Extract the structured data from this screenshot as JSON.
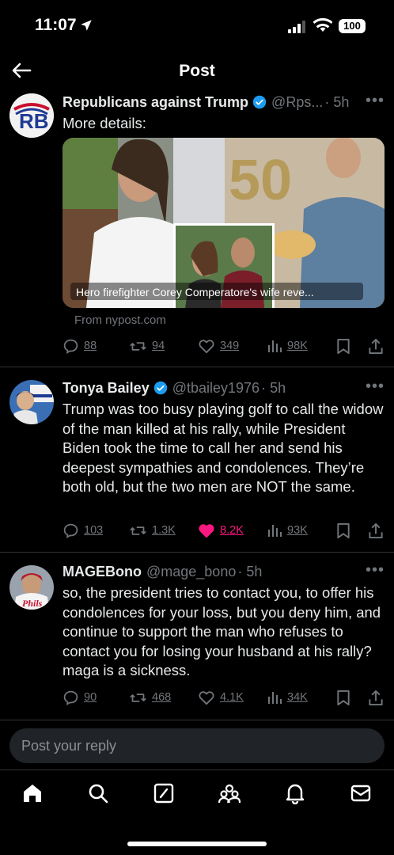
{
  "status_bar": {
    "time": "11:07",
    "battery": "100"
  },
  "header": {
    "title": "Post"
  },
  "posts": [
    {
      "name": "Republicans against Trump",
      "handle": "@Rps...",
      "time": "· 5h",
      "text": "More details:",
      "avatar_text": "RB",
      "link_caption": "Hero firefighter Corey Comperatore's wife reve...",
      "link_source": "From nypost.com",
      "replies": "88",
      "reposts": "94",
      "likes": "349",
      "views": "98K"
    },
    {
      "name": "Tonya Bailey",
      "handle": "@tbailey1976",
      "time": "· 5h",
      "text": "Trump was too busy playing golf to call the widow of the man killed at his rally, while President Biden took the time to call her and send his deepest sympathies and condolences. They’re both old, but the two men are NOT the same.",
      "replies": "103",
      "reposts": "1.3K",
      "likes": "8.2K",
      "views": "93K"
    },
    {
      "name": "MAGEBono",
      "handle": "@mage_bono",
      "time": "· 5h",
      "text": "so, the president tries to contact you, to offer his condolences for your loss, but you deny him, and continue to support the man who refuses to contact you for losing your husband at his rally? maga is a sickness.",
      "replies": "90",
      "reposts": "468",
      "likes": "4.1K",
      "views": "34K"
    }
  ],
  "reply_bar": {
    "placeholder": "Post your reply"
  },
  "colors": {
    "background": "#000000",
    "accent": "#1d9bf0",
    "like": "#f91880",
    "muted": "#71767b"
  },
  "icons": [
    "arrow-left-icon",
    "verified-icon",
    "more-icon",
    "reply-icon",
    "repost-icon",
    "like-icon",
    "views-icon",
    "bookmark-icon",
    "share-icon",
    "home-icon",
    "search-icon",
    "compose-icon",
    "communities-icon",
    "notifications-icon",
    "messages-icon"
  ]
}
